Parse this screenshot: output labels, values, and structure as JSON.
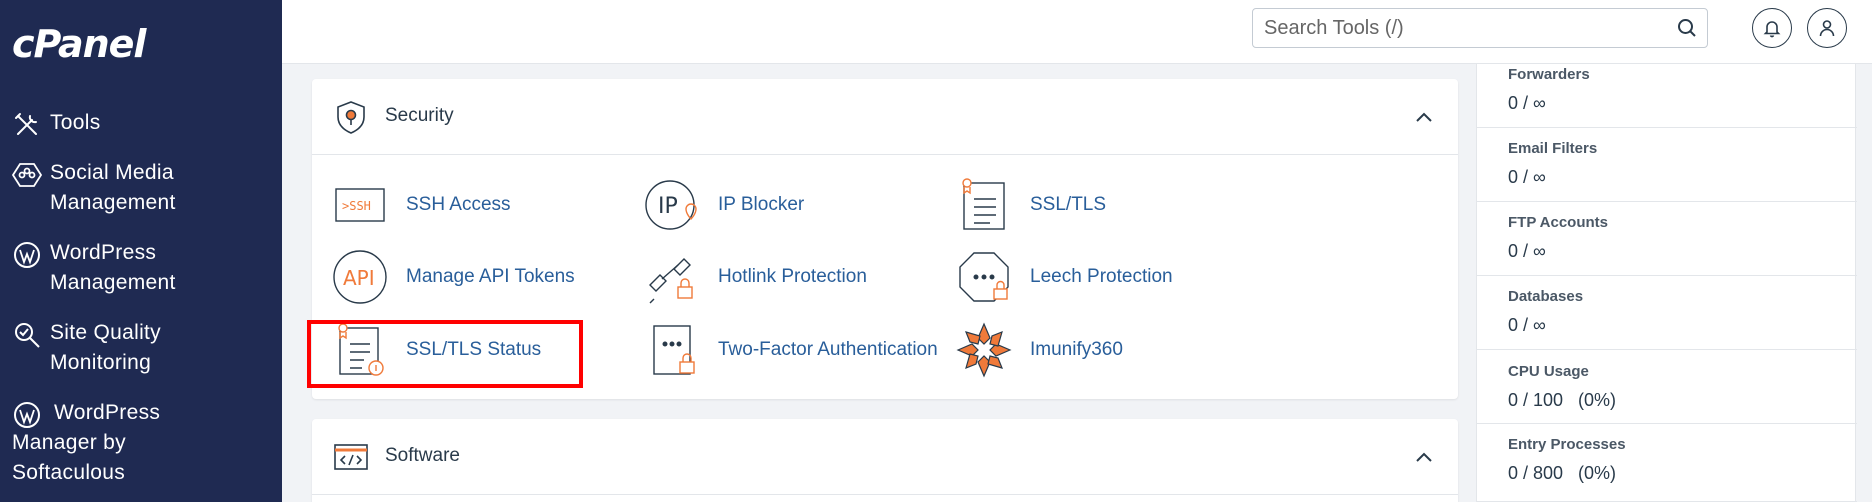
{
  "app": {
    "logo": "cPanel"
  },
  "sidebar": {
    "items": [
      {
        "label": "Tools",
        "icon": "tools-icon"
      },
      {
        "label": "Social Media\n   Management",
        "icon": "social-media-icon"
      },
      {
        "label": "WordPress\n   Management",
        "icon": "wordpress-icon"
      },
      {
        "label": "Site Quality\n   Monitoring",
        "icon": "site-quality-icon"
      },
      {
        "label": "WordPress\nManager by\nSoftaculous",
        "icon": "wordpress-icon"
      }
    ]
  },
  "header": {
    "search": {
      "placeholder": "Search Tools (/)",
      "value": ""
    },
    "icons": [
      "search-icon",
      "bell-icon",
      "user-icon"
    ]
  },
  "security": {
    "title": "Security",
    "tools": [
      {
        "label": "SSH Access",
        "icon": "ssh-icon"
      },
      {
        "label": "IP Blocker",
        "icon": "ip-blocker-icon"
      },
      {
        "label": "SSL/TLS",
        "icon": "ssl-tls-icon"
      },
      {
        "label": "Manage API Tokens",
        "icon": "api-tokens-icon"
      },
      {
        "label": "Hotlink Protection",
        "icon": "hotlink-icon"
      },
      {
        "label": "Leech Protection",
        "icon": "leech-icon"
      },
      {
        "label": "SSL/TLS Status",
        "icon": "ssl-status-icon"
      },
      {
        "label": "Two-Factor Authentication",
        "icon": "two-factor-icon"
      },
      {
        "label": "Imunify360",
        "icon": "imunify-icon"
      }
    ]
  },
  "software": {
    "title": "Software"
  },
  "stats": [
    {
      "label": "Forwarders",
      "value": "0 / ∞"
    },
    {
      "label": "Email Filters",
      "value": "0 / ∞"
    },
    {
      "label": "FTP Accounts",
      "value": "0 / ∞"
    },
    {
      "label": "Databases",
      "value": "0 / ∞"
    },
    {
      "label": "CPU Usage",
      "value": "0 / 100   (0%)"
    },
    {
      "label": "Entry Processes",
      "value": "0 / 800   (0%)"
    }
  ],
  "colors": {
    "sidebar_bg": "#1f2a52",
    "link": "#295e9a",
    "accent_orange": "#f07a3a",
    "highlight": "#ff0000"
  }
}
